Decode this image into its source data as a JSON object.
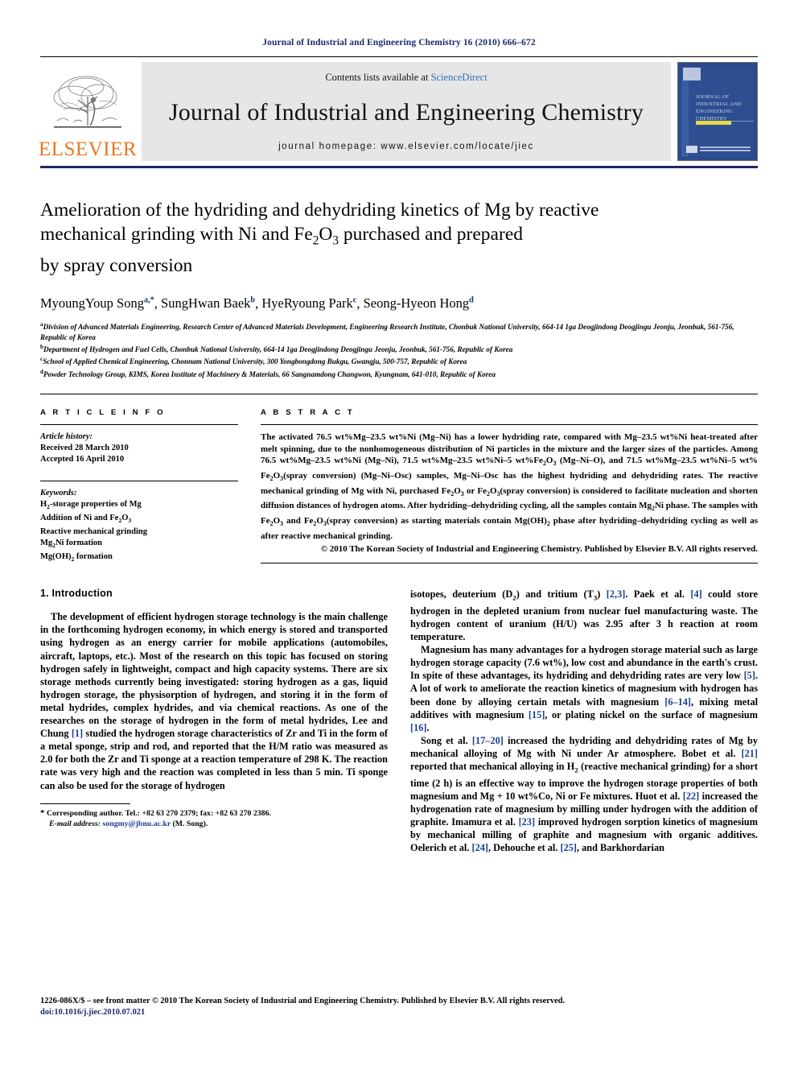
{
  "running_head": "Journal of Industrial and Engineering Chemistry 16 (2010) 666–672",
  "masthead": {
    "contents_prefix": "Contents lists available at ",
    "sciencedirect": "ScienceDirect",
    "journal_name": "Journal of Industrial and Engineering Chemistry",
    "homepage": "journal homepage: www.elsevier.com/locate/jiec",
    "publisher_wordmark": "ELSEVIER",
    "cover": {
      "line1": "JOURNAL OF",
      "line2": "INDUSTRIAL AND",
      "line3": "ENGINEERING",
      "line4": "CHEMISTRY"
    },
    "accent_blue": "#2e6ec4",
    "elsevier_orange": "#E87722",
    "cover_navy": "#2d4e91"
  },
  "article": {
    "title_line1": "Amelioration of the hydriding and dehydriding kinetics of Mg by reactive",
    "title_line2_a": "mechanical grinding with Ni and Fe",
    "title_line2_sub1": "2",
    "title_line2_b": "O",
    "title_line2_sub2": "3",
    "title_line2_c": " purchased and prepared",
    "title_line3": "by spray conversion",
    "authors": [
      {
        "name": "MyoungYoup Song",
        "marks": "a,*"
      },
      {
        "name": "SungHwan Baek",
        "marks": "b"
      },
      {
        "name": "HyeRyoung Park",
        "marks": "c"
      },
      {
        "name": "Seong-Hyeon Hong",
        "marks": "d"
      }
    ],
    "affiliations": [
      {
        "mark": "a",
        "text": "Division of Advanced Materials Engineering, Research Center of Advanced Materials Development, Engineering Research Institute, Chonbuk National University, 664-14 1ga Deogjindong Deogjingu Jeonju, Jeonbuk, 561-756, Republic of Korea"
      },
      {
        "mark": "b",
        "text": "Department of Hydrogen and Fuel Cells, Chonbuk National University, 664-14 1ga Deogjindong Deogjingu Jeonju, Jeonbuk, 561-756, Republic of Korea"
      },
      {
        "mark": "c",
        "text": "School of Applied Chemical Engineering, Chonnam National University, 300 Yongbongdong Bukgu, Gwangju, 500-757, Republic of Korea"
      },
      {
        "mark": "d",
        "text": "Powder Technology Group, KIMS, Korea Institute of Machinery & Materials, 66 Sangnamdong Changwon, Kyungnam, 641-010, Republic of Korea"
      }
    ]
  },
  "article_info": {
    "heading": "A R T I C L E   I N F O",
    "history_label": "Article history:",
    "received": "Received 28 March 2010",
    "accepted": "Accepted 16 April 2010",
    "keywords_label": "Keywords:",
    "keywords": [
      "H2-storage properties of Mg",
      "Addition of Ni and Fe2O3",
      "Reactive mechanical grinding",
      "Mg2Ni formation",
      "Mg(OH)2 formation"
    ]
  },
  "abstract": {
    "heading": "A B S T R A C T",
    "text": "The activated 76.5 wt%Mg–23.5 wt%Ni (Mg–Ni) has a lower hydriding rate, compared with Mg–23.5 wt%Ni heat-treated after melt spinning, due to the nonhomogeneous distribution of Ni particles in the mixture and the larger sizes of the particles. Among 76.5 wt%Mg–23.5 wt%Ni (Mg–Ni), 71.5 wt%Mg–23.5 wt%Ni–5 wt%Fe2O3 (Mg–Ni–O), and 71.5 wt%Mg–23.5 wt%Ni–5 wt% Fe2O3(spray conversion) (Mg–Ni–Osc) samples, Mg–Ni–Osc has the highest hydriding and dehydriding rates. The reactive mechanical grinding of Mg with Ni, purchased Fe2O3 or Fe2O3(spray conversion) is considered to facilitate nucleation and shorten diffusion distances of hydrogen atoms. After hydriding–dehydriding cycling, all the samples contain Mg2Ni phase. The samples with Fe2O3 and Fe2O3(spray conversion) as starting materials contain Mg(OH)2 phase after hydriding–dehydriding cycling as well as after reactive mechanical grinding.",
    "copyright": "© 2010 The Korean Society of Industrial and Engineering Chemistry. Published by Elsevier B.V. All rights reserved."
  },
  "section": {
    "number_title": "1. Introduction",
    "left_para_1": "The development of efficient hydrogen storage technology is the main challenge in the forthcoming hydrogen economy, in which energy is stored and transported using hydrogen as an energy carrier for mobile applications (automobiles, aircraft, laptops, etc.). Most of the research on this topic has focused on storing hydrogen safely in lightweight, compact and high capacity systems. There are six storage methods currently being investigated: storing hydrogen as a gas, liquid hydrogen storage, the physisorption of hydrogen, and storing it in the form of metal hydrides, complex hydrides, and via chemical reactions. As one of the researches on the storage of hydrogen in the form of metal hydrides, Lee and Chung [1] studied the hydrogen storage characteristics of Zr and Ti in the form of a metal sponge, strip and rod, and reported that the H/M ratio was measured as 2.0 for both the Zr and Ti sponge at a reaction temperature of 298 K. The reaction rate was very high and the reaction was completed in less than 5 min. Ti sponge can also be used for the storage of hydrogen",
    "right_para_1": "isotopes, deuterium (D2) and tritium (T3) [2,3]. Paek et al. [4] could store hydrogen in the depleted uranium from nuclear fuel manufacturing waste. The hydrogen content of uranium (H/U) was 2.95 after 3 h reaction at room temperature.",
    "right_para_2": "Magnesium has many advantages for a hydrogen storage material such as large hydrogen storage capacity (7.6 wt%), low cost and abundance in the earth's crust. In spite of these advantages, its hydriding and dehydriding rates are very low [5]. A lot of work to ameliorate the reaction kinetics of magnesium with hydrogen has been done by alloying certain metals with magnesium [6–14], mixing metal additives with magnesium [15], or plating nickel on the surface of magnesium [16].",
    "right_para_3": "Song et al. [17–20] increased the hydriding and dehydriding rates of Mg by mechanical alloying of Mg with Ni under Ar atmosphere. Bobet et al. [21] reported that mechanical alloying in H2 (reactive mechanical grinding) for a short time (2 h) is an effective way to improve the hydrogen storage properties of both magnesium and Mg + 10 wt%Co, Ni or Fe mixtures. Huot et al. [22] increased the hydrogenation rate of magnesium by milling under hydrogen with the addition of graphite. Imamura et al. [23] improved hydrogen sorption kinetics of magnesium by mechanical milling of graphite and magnesium with organic additives. Oelerich et al. [24], Dehouche et al. [25], and Barkhordarian"
  },
  "footnote": {
    "corresponding": "Corresponding author. Tel.: +82 63 270 2379; fax: +82 63 270 2386.",
    "email_label": "E-mail address:",
    "email": "songmy@jbnu.ac.kr",
    "email_suffix": "(M. Song)."
  },
  "page_footer": {
    "issn_line": "1226-086X/$ – see front matter © 2010 The Korean Society of Industrial and Engineering Chemistry. Published by Elsevier B.V. All rights reserved.",
    "doi": "doi:10.1016/j.jiec.2010.07.021"
  }
}
